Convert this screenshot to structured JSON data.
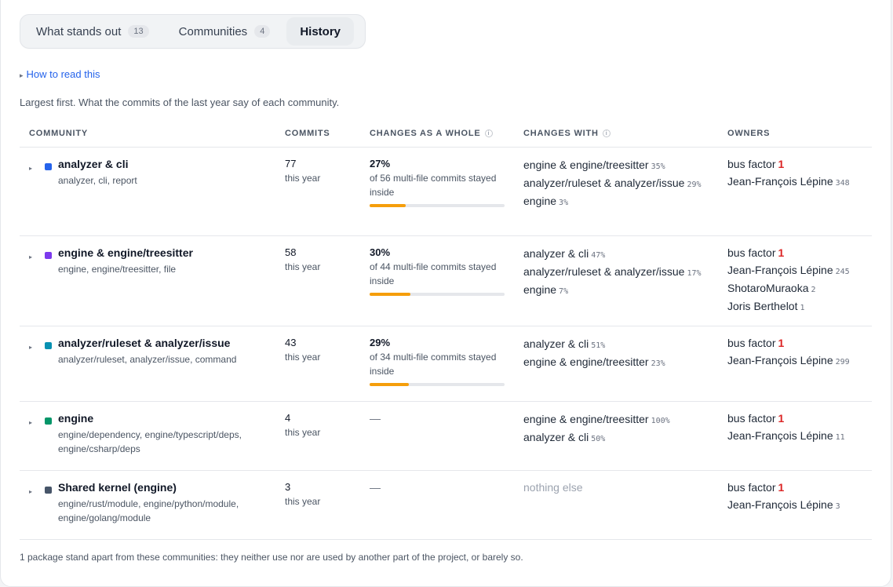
{
  "tabs": [
    {
      "label": "What stands out",
      "count": "13"
    },
    {
      "label": "Communities",
      "count": "4"
    },
    {
      "label": "History"
    }
  ],
  "howto_link": "How to read this",
  "lede": "Largest first. What the commits of the last year say of each community.",
  "columns": {
    "community": "COMMUNITY",
    "commits": "COMMITS",
    "whole": "CHANGES AS A WHOLE",
    "with": "CHANGES WITH",
    "owners": "OWNERS"
  },
  "rows": [
    {
      "name": "analyzer & cli",
      "color": "#2563eb",
      "packages": "analyzer, cli, report",
      "commits": "77",
      "period": "this year",
      "whole_pct": "27%",
      "whole_desc": "of 56 multi-file commits stayed inside",
      "whole_fraction": 0.27,
      "with": [
        {
          "name": "engine & engine/treesitter",
          "pct": "35%"
        },
        {
          "name": "analyzer/ruleset & analyzer/issue",
          "pct": "29%"
        },
        {
          "name": "engine",
          "pct": "3%"
        }
      ],
      "bus_label": "bus factor",
      "bus_factor": "1",
      "owners": [
        {
          "name": "Jean-François Lépine",
          "count": "348"
        }
      ]
    },
    {
      "name": "engine & engine/treesitter",
      "color": "#7c3aed",
      "packages": "engine, engine/treesitter, file",
      "commits": "58",
      "period": "this year",
      "whole_pct": "30%",
      "whole_desc": "of 44 multi-file commits stayed inside",
      "whole_fraction": 0.3,
      "with": [
        {
          "name": "analyzer & cli",
          "pct": "47%"
        },
        {
          "name": "analyzer/ruleset & analyzer/issue",
          "pct": "17%"
        },
        {
          "name": "engine",
          "pct": "7%"
        }
      ],
      "bus_label": "bus factor",
      "bus_factor": "1",
      "owners": [
        {
          "name": "Jean-François Lépine",
          "count": "245"
        },
        {
          "name": "ShotaroMuraoka",
          "count": "2"
        },
        {
          "name": "Joris Berthelot",
          "count": "1"
        }
      ]
    },
    {
      "name": "analyzer/ruleset & analyzer/issue",
      "color": "#0891b2",
      "packages": "analyzer/ruleset, analyzer/issue, command",
      "commits": "43",
      "period": "this year",
      "whole_pct": "29%",
      "whole_desc": "of 34 multi-file commits stayed inside",
      "whole_fraction": 0.29,
      "with": [
        {
          "name": "analyzer & cli",
          "pct": "51%"
        },
        {
          "name": "engine & engine/treesitter",
          "pct": "23%"
        }
      ],
      "bus_label": "bus factor",
      "bus_factor": "1",
      "owners": [
        {
          "name": "Jean-François Lépine",
          "count": "299"
        }
      ]
    },
    {
      "name": "engine",
      "color": "#059669",
      "packages": "engine/dependency, engine/typescript/deps, engine/csharp/deps",
      "commits": "4",
      "period": "this year",
      "whole_dash": "—",
      "with": [
        {
          "name": "engine & engine/treesitter",
          "pct": "100%"
        },
        {
          "name": "analyzer & cli",
          "pct": "50%"
        }
      ],
      "bus_label": "bus factor",
      "bus_factor": "1",
      "owners": [
        {
          "name": "Jean-François Lépine",
          "count": "11"
        }
      ]
    },
    {
      "name": "Shared kernel (engine)",
      "color": "#475569",
      "packages": "engine/rust/module, engine/python/module, engine/golang/module",
      "commits": "3",
      "period": "this year",
      "whole_dash": "—",
      "with": [],
      "with_empty": "nothing else",
      "bus_label": "bus factor",
      "bus_factor": "1",
      "owners": [
        {
          "name": "Jean-François Lépine",
          "count": "3"
        }
      ]
    }
  ],
  "footnote": "1 package stand apart from these communities: they neither use nor are used by another part of the project, or barely so."
}
